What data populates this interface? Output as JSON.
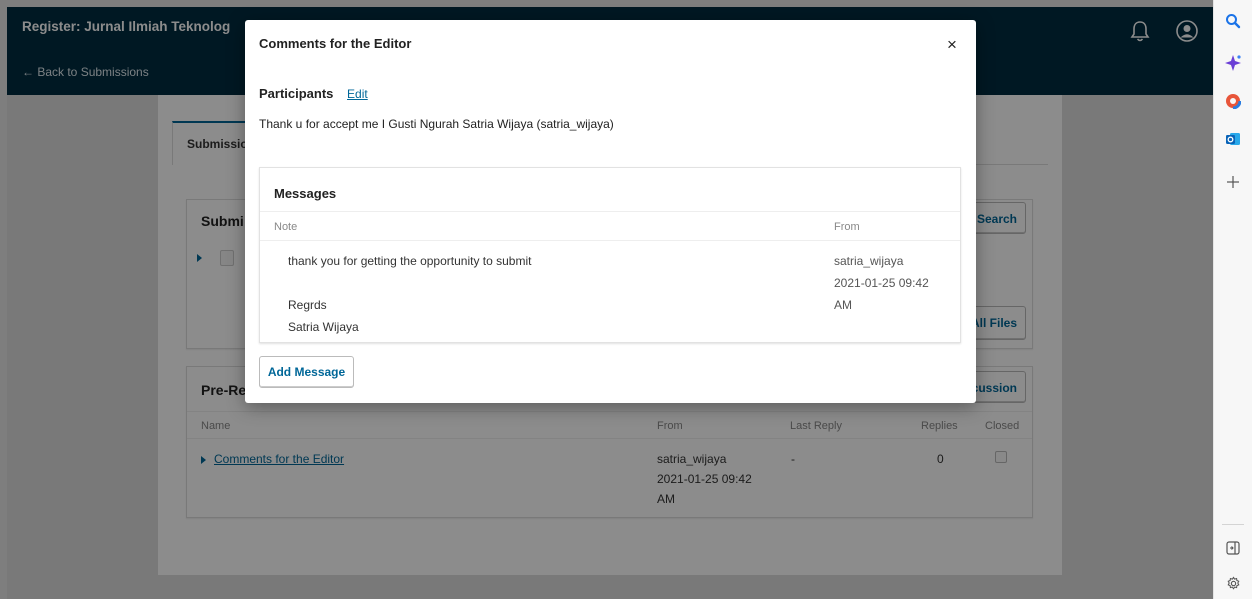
{
  "header": {
    "title": "Register: Jurnal Ilmiah Teknolog",
    "back_link": "← Back to Submissions"
  },
  "tabs": {
    "active_label": "Submissio"
  },
  "submission_files": {
    "heading": "Submi",
    "search_button": "Search",
    "view_all_button": "All Files"
  },
  "pre_review": {
    "heading": "Pre-Re",
    "add_discussion_button": "cussion",
    "columns": {
      "name": "Name",
      "from": "From",
      "last_reply": "Last Reply",
      "replies": "Replies",
      "closed": "Closed"
    },
    "rows": [
      {
        "name": "Comments for the Editor",
        "from_user": "satria_wijaya",
        "from_date": "2021-01-25 09:42",
        "from_ampm": "AM",
        "last_reply": "-",
        "replies": "0"
      }
    ]
  },
  "modal": {
    "title": "Comments for the Editor",
    "close_glyph": "×",
    "participants_label": "Participants",
    "edit_label": "Edit",
    "participants_text": "Thank u for accept me I Gusti Ngurah Satria Wijaya (satria_wijaya)",
    "messages_heading": "Messages",
    "columns": {
      "note": "Note",
      "from": "From"
    },
    "message": {
      "line1": "thank you for getting the opportunity to submit",
      "line2": "Regrds",
      "line3": "Satria Wijaya",
      "from_user": "satria_wijaya",
      "from_date": "2021-01-25 09:42",
      "from_ampm": "AM"
    },
    "add_message_button": "Add Message"
  },
  "colors": {
    "header_bg": "#002c40",
    "link": "#006798",
    "overlay": "rgba(0,0,0,0.45)"
  },
  "sidebar_icons": [
    "search-icon",
    "copilot-sparkle-icon",
    "office-icon",
    "outlook-icon",
    "plus-icon",
    "sidebar-toggle-icon",
    "settings-gear-icon"
  ]
}
